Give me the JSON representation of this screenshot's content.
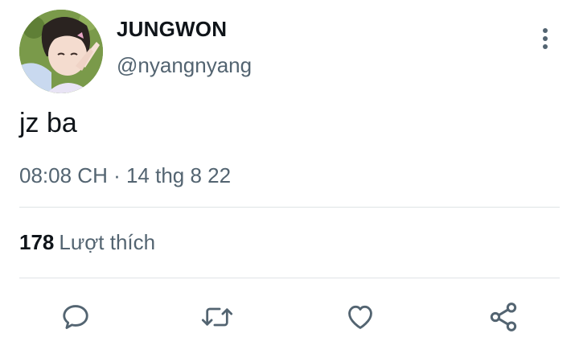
{
  "author": {
    "display_name": "JUNGWON",
    "handle": "@nyangnyang",
    "avatar_icon": "profile-photo"
  },
  "tweet": {
    "text": "jz ba",
    "timestamp": "08:08 CH · 14 thg 8 22"
  },
  "stats": {
    "likes_count": "178",
    "likes_label": "Lượt thích"
  },
  "actions": [
    {
      "name": "reply",
      "icon": "speech-bubble-icon"
    },
    {
      "name": "retweet",
      "icon": "retweet-arrows-icon"
    },
    {
      "name": "like",
      "icon": "heart-outline-icon"
    },
    {
      "name": "share",
      "icon": "share-nodes-icon"
    }
  ],
  "colors": {
    "text_primary": "#0f1419",
    "text_secondary": "#536471",
    "divider": "#dfe3e6"
  }
}
